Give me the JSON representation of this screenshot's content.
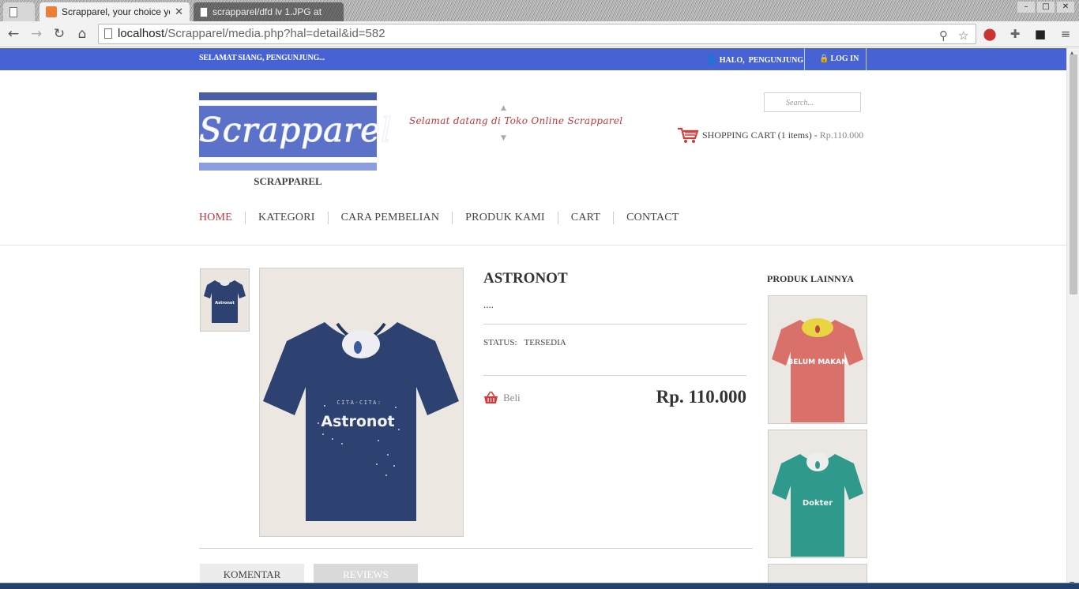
{
  "browser": {
    "tabs": [
      {
        "label": "Scrapparel, your choice yo",
        "active": true
      },
      {
        "label": "scrapparel/dfd lv 1.JPG at",
        "active": false
      }
    ],
    "url_host": "localhost",
    "url_path": "/Scrapparel/media.php?hal=detail&id=582"
  },
  "topbar": {
    "greeting": "SELAMAT SIANG, PENGUNJUNG...",
    "halo_prefix": "HALO,",
    "halo_user": "PENGUNJUNG",
    "login_label": "LOG IN"
  },
  "header": {
    "logo_text": "Scrapparel",
    "site_name": "SCRAPPAREL",
    "welcome_marquee": "Selamat datang di Toko Online Scrapparel",
    "search_placeholder": "Search...",
    "cart_text": "SHOPPING CART (1 items) - ",
    "cart_price": "Rp.110.000"
  },
  "nav": {
    "items": [
      "HOME",
      "KATEGORI",
      "CARA PEMBELIAN",
      "PRODUK KAMI",
      "CART",
      "CONTACT"
    ],
    "current": "HOME"
  },
  "product": {
    "title": "ASTRONOT",
    "description": "....",
    "status_label": "STATUS:",
    "status_value": "TERSEDIA",
    "buy_label": "Beli",
    "price": "Rp. 110.000",
    "shirt_color": "#2d4271",
    "print_small": "CITA-CITA:",
    "print_big": "Astronot"
  },
  "sidebar": {
    "title": "PRODUK LAINNYA",
    "products": [
      {
        "shirt_color": "#d9706a",
        "collar_color": "#e8d541",
        "print": "BELUM MAKAN"
      },
      {
        "shirt_color": "#2f9a8c",
        "collar_color": "#eeeeee",
        "print": "Dokter"
      }
    ]
  },
  "tabs": {
    "komentar": "KOMENTAR",
    "reviews": "REVIEWS"
  },
  "colors": {
    "accent_blue": "#4763d3",
    "accent_red": "#c2363a"
  }
}
